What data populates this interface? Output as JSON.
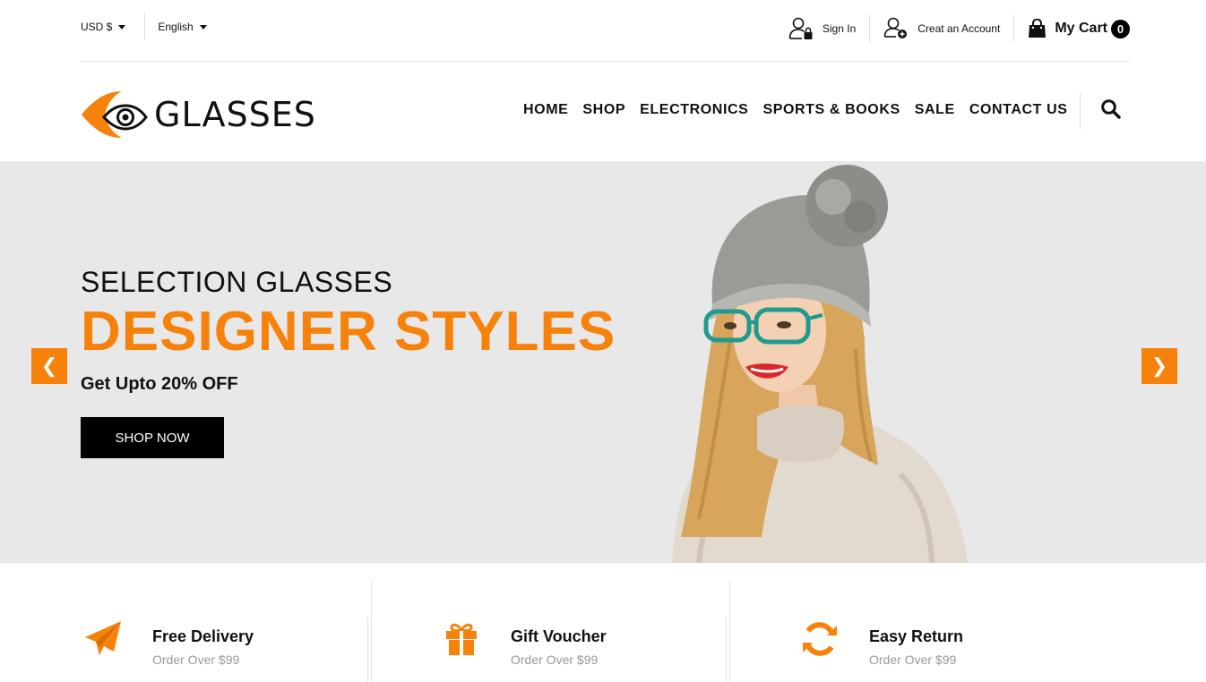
{
  "topbar": {
    "currency": "USD $",
    "language": "English",
    "sign_in": "Sign In",
    "create_account": "Creat an Account",
    "cart_label": "My Cart",
    "cart_count": "0"
  },
  "header": {
    "logo_text": "GLASSES",
    "nav": [
      "HOME",
      "SHOP",
      "ELECTRONICS",
      "SPORTS & BOOKS",
      "SALE",
      "CONTACT US"
    ]
  },
  "hero": {
    "subtitle": "SELECTION GLASSES",
    "title": "DESIGNER STYLES",
    "offer": "Get Upto 20% OFF",
    "button": "SHOP NOW",
    "prev": "❮",
    "next": "❯"
  },
  "features": [
    {
      "icon": "paper-plane-icon",
      "title": "Free Delivery",
      "desc": "Order Over $99"
    },
    {
      "icon": "gift-icon",
      "title": "Gift Voucher",
      "desc": "Order Over $99"
    },
    {
      "icon": "refresh-icon",
      "title": "Easy Return",
      "desc": "Order Over $99"
    }
  ],
  "colors": {
    "accent": "#f7820b",
    "hero_bg": "#e8e8e8",
    "text": "#111111",
    "muted": "#999999"
  }
}
